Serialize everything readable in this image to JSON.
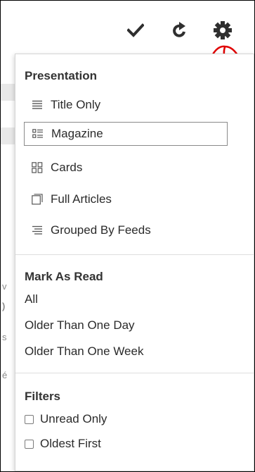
{
  "toolbar": {
    "icons": [
      "checkmark-icon",
      "refresh-icon",
      "gear-icon"
    ]
  },
  "background_text": [
    "v",
    ")",
    "s",
    "é"
  ],
  "menu": {
    "presentation": {
      "title": "Presentation",
      "options": [
        {
          "label": "Title Only",
          "icon": "title-only-icon",
          "selected": false
        },
        {
          "label": "Magazine",
          "icon": "magazine-icon",
          "selected": true
        },
        {
          "label": "Cards",
          "icon": "cards-icon",
          "selected": false
        },
        {
          "label": "Full Articles",
          "icon": "full-articles-icon",
          "selected": false
        },
        {
          "label": "Grouped By Feeds",
          "icon": "grouped-by-feeds-icon",
          "selected": false
        }
      ]
    },
    "mark_as_read": {
      "title": "Mark As Read",
      "items": [
        "All",
        "Older Than One Day",
        "Older Than One Week"
      ]
    },
    "filters": {
      "title": "Filters",
      "items": [
        {
          "label": "Unread Only",
          "checked": false
        },
        {
          "label": "Oldest First",
          "checked": false
        }
      ]
    }
  },
  "colors": {
    "icon": "#2f2f2f",
    "text": "#2b2b2b",
    "annotation": "#e00000",
    "selected_border": "#8a8a8a"
  }
}
